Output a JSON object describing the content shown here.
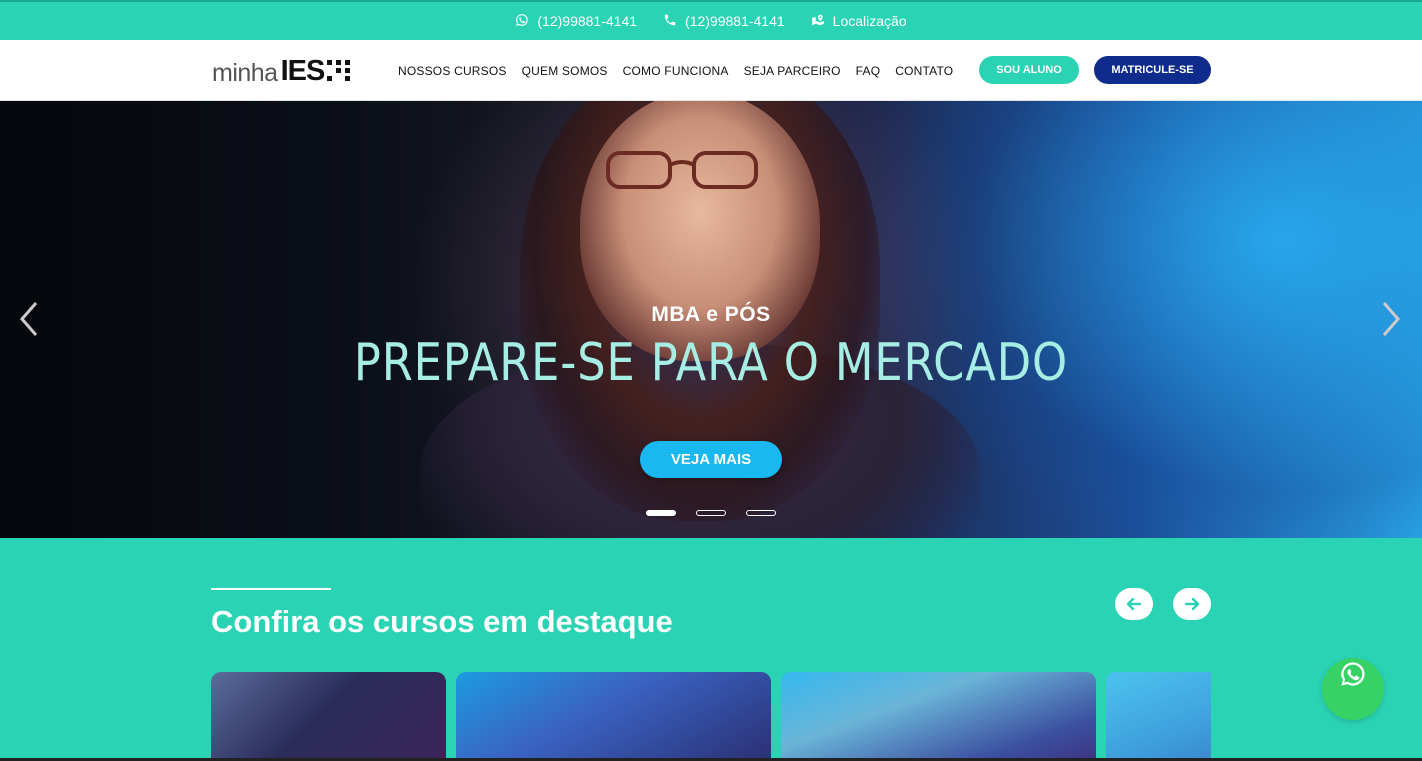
{
  "topbar": {
    "whatsapp_phone": "(12)99881-4141",
    "phone": "(12)99881-4141",
    "location": "Localização",
    "icons": [
      "whatsapp-icon",
      "phone-icon",
      "map-icon"
    ]
  },
  "header": {
    "logo_text_1": "minha",
    "logo_text_2": "IES",
    "nav": [
      "NOSSOS CURSOS",
      "QUEM SOMOS",
      "COMO FUNCIONA",
      "SEJA PARCEIRO",
      "FAQ",
      "CONTATO"
    ],
    "btn_aluno": "SOU ALUNO",
    "btn_matricule": "MATRICULE-SE"
  },
  "hero": {
    "subtitle": "MBA e PÓS",
    "title": "PREPARE-SE PARA O MERCADO",
    "cta": "VEJA MAIS",
    "slides": 3,
    "active_slide": 1
  },
  "featured": {
    "title": "Confira os cursos em destaque"
  },
  "colors": {
    "primary": "#2ad3b4",
    "navy": "#0f2b8c",
    "cta": "#1ab8f0",
    "whatsapp": "#37d266"
  }
}
